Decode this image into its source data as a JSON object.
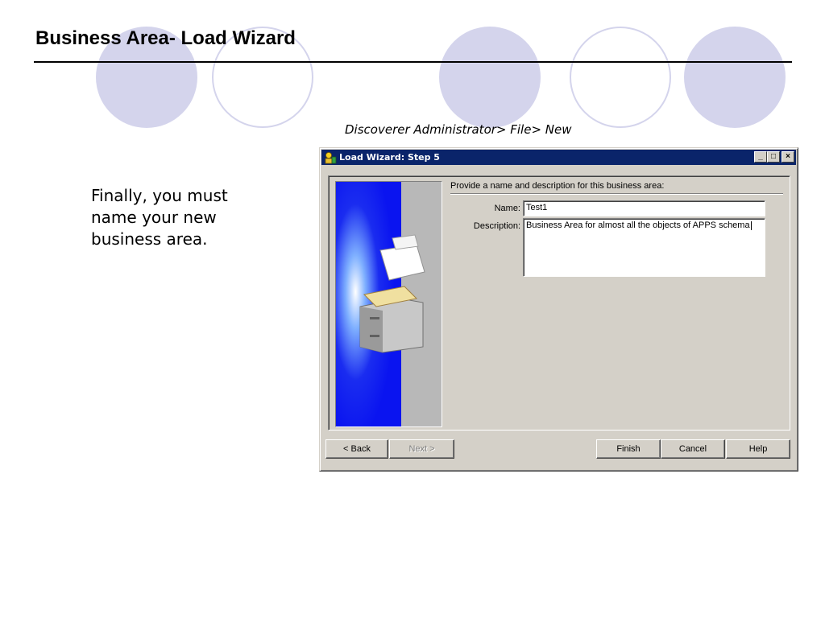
{
  "slide": {
    "title": "Business Area- Load Wizard",
    "caption": "Discoverer Administrator> File> New",
    "body_lines": [
      "Finally, you must",
      "name your new",
      "business area."
    ]
  },
  "dialog": {
    "title": "Load Wizard: Step 5",
    "controls": {
      "minimize": "_",
      "maximize": "□",
      "close": "×"
    },
    "prompt": "Provide a name and description for this business area:",
    "name_label": "Name:",
    "name_value": "Test1",
    "description_label": "Description:",
    "description_value": "Business Area for almost all the objects of APPS schema",
    "buttons": {
      "back": "< Back",
      "next": "Next >",
      "finish": "Finish",
      "cancel": "Cancel",
      "help": "Help"
    }
  },
  "colors": {
    "titlebar": "#0a246a",
    "dialog_bg": "#d4d0c8",
    "decor_circle": "#d4d4ec",
    "banner_blue": "#0a14f0"
  }
}
